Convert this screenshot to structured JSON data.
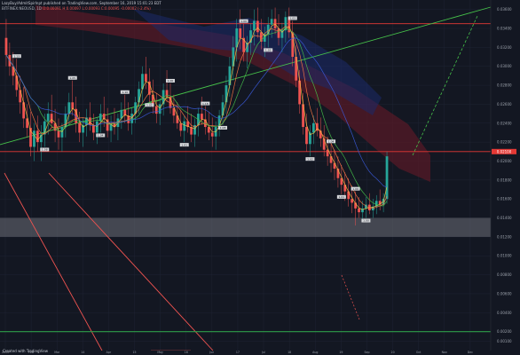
{
  "header": {
    "line1": "LazyBuy/AdmitSpirInpt published on TradingView.com, September 16, 2019 15:01:23 EDT",
    "line2_symbol": "BITFINEX:NEOUSD, 1D",
    "line2_ohlc": "O:0.00091 H:0.00097 L:0.00093 C:0.00095 -0.00002 (-2.4%)"
  },
  "footer": {
    "text": "Created with TradingView"
  },
  "chart_data": {
    "type": "candlestick",
    "colors": {
      "background": "#131722",
      "grid": "#1f2433",
      "up": "#26a69a",
      "down": "#ef5350",
      "cloud": "#5a1a26",
      "cloud_alt": "#1c2a6a",
      "zone": "#6e7078",
      "trendline": "#46c24a",
      "level_red": "#e53935",
      "level_green": "#2e9d48",
      "projection": "#46c24a"
    },
    "y_ticks": [
      "0.03600",
      "0.03400",
      "0.03200",
      "0.03000",
      "0.02800",
      "0.02600",
      "0.02400",
      "0.02200",
      "0.02000",
      "0.01800",
      "0.01600",
      "0.01400",
      "0.01200",
      "0.01000",
      "0.00800",
      "0.00600",
      "0.00400",
      "0.00200",
      "0.00100"
    ],
    "x_ticks": [
      "2019",
      "Feb",
      "Mar",
      "14",
      "Apr",
      "15",
      "May",
      "16",
      "Jun",
      "17",
      "Jul",
      "18",
      "Aug",
      "19",
      "Sep",
      "20",
      "Oct",
      "Nov",
      "Dec"
    ],
    "price_badge": "0.02100",
    "level_red_top": "0.03450",
    "level_red_mid": "0.02100",
    "level_green_bottom": "0.00200",
    "zone": [
      "0.01400",
      "0.01200"
    ],
    "pivot_labels": [
      "1.13",
      "1.08",
      "1.05",
      "1.04",
      "1.10",
      "1.02",
      "1.00",
      "1.01",
      "1.18",
      "1.08",
      "1.00",
      "1.03",
      "1.03",
      "1.02",
      "1.04",
      "1.01",
      "1.00",
      "1.00"
    ],
    "candles": [
      [
        0.033,
        0.035,
        0.03,
        0.0312
      ],
      [
        0.0312,
        0.0325,
        0.029,
        0.03
      ],
      [
        0.03,
        0.0315,
        0.028,
        0.029
      ],
      [
        0.029,
        0.0308,
        0.0268,
        0.0275
      ],
      [
        0.0275,
        0.029,
        0.025,
        0.0262
      ],
      [
        0.0262,
        0.0278,
        0.0235,
        0.0245
      ],
      [
        0.0245,
        0.026,
        0.0225,
        0.0235
      ],
      [
        0.0235,
        0.0252,
        0.0205,
        0.0215
      ],
      [
        0.0215,
        0.024,
        0.02,
        0.0232
      ],
      [
        0.0232,
        0.0248,
        0.021,
        0.022
      ],
      [
        0.022,
        0.0238,
        0.02,
        0.0228
      ],
      [
        0.0228,
        0.025,
        0.0215,
        0.0242
      ],
      [
        0.0242,
        0.0262,
        0.0228,
        0.025
      ],
      [
        0.025,
        0.027,
        0.0235,
        0.024
      ],
      [
        0.024,
        0.0255,
        0.022,
        0.0232
      ],
      [
        0.0232,
        0.0245,
        0.0212,
        0.0225
      ],
      [
        0.0225,
        0.024,
        0.021,
        0.0236
      ],
      [
        0.0236,
        0.0258,
        0.0225,
        0.025
      ],
      [
        0.025,
        0.0272,
        0.0238,
        0.0262
      ],
      [
        0.0262,
        0.0285,
        0.0248,
        0.0255
      ],
      [
        0.0255,
        0.0268,
        0.023,
        0.024
      ],
      [
        0.024,
        0.0252,
        0.022,
        0.023
      ],
      [
        0.023,
        0.0246,
        0.0215,
        0.0238
      ],
      [
        0.0238,
        0.0255,
        0.0226,
        0.0246
      ],
      [
        0.0246,
        0.0262,
        0.0232,
        0.0238
      ],
      [
        0.0238,
        0.025,
        0.0222,
        0.023
      ],
      [
        0.023,
        0.0246,
        0.0218,
        0.0242
      ],
      [
        0.0242,
        0.026,
        0.023,
        0.025
      ],
      [
        0.025,
        0.0268,
        0.0236,
        0.0244
      ],
      [
        0.0244,
        0.0256,
        0.0225,
        0.0232
      ],
      [
        0.0232,
        0.0248,
        0.022,
        0.024
      ],
      [
        0.024,
        0.0256,
        0.0228,
        0.0236
      ],
      [
        0.0236,
        0.025,
        0.0222,
        0.0245
      ],
      [
        0.0245,
        0.0262,
        0.0234,
        0.0254
      ],
      [
        0.0254,
        0.027,
        0.024,
        0.0248
      ],
      [
        0.0248,
        0.0262,
        0.0232,
        0.024
      ],
      [
        0.024,
        0.0256,
        0.0228,
        0.025
      ],
      [
        0.025,
        0.0268,
        0.024,
        0.0262
      ],
      [
        0.0262,
        0.0284,
        0.025,
        0.0276
      ],
      [
        0.0276,
        0.03,
        0.0262,
        0.0292
      ],
      [
        0.0292,
        0.031,
        0.0276,
        0.0284
      ],
      [
        0.0284,
        0.0298,
        0.0262,
        0.027
      ],
      [
        0.027,
        0.0286,
        0.025,
        0.0258
      ],
      [
        0.0258,
        0.0272,
        0.024,
        0.025
      ],
      [
        0.025,
        0.0266,
        0.0238,
        0.026
      ],
      [
        0.026,
        0.0282,
        0.0248,
        0.0275
      ],
      [
        0.0275,
        0.0296,
        0.0262,
        0.0268
      ],
      [
        0.0268,
        0.0282,
        0.025,
        0.0256
      ],
      [
        0.0256,
        0.027,
        0.024,
        0.0248
      ],
      [
        0.0248,
        0.0262,
        0.0234,
        0.024
      ],
      [
        0.024,
        0.0254,
        0.0226,
        0.0232
      ],
      [
        0.0232,
        0.0248,
        0.022,
        0.0242
      ],
      [
        0.0242,
        0.0258,
        0.023,
        0.0236
      ],
      [
        0.0236,
        0.025,
        0.022,
        0.0228
      ],
      [
        0.0228,
        0.0245,
        0.0215,
        0.0238
      ],
      [
        0.0238,
        0.0256,
        0.0226,
        0.025
      ],
      [
        0.025,
        0.0268,
        0.0238,
        0.0244
      ],
      [
        0.0244,
        0.0258,
        0.0228,
        0.0236
      ],
      [
        0.0236,
        0.0252,
        0.0222,
        0.023
      ],
      [
        0.023,
        0.0246,
        0.0215,
        0.0226
      ],
      [
        0.0226,
        0.0242,
        0.0212,
        0.0236
      ],
      [
        0.0236,
        0.0254,
        0.0226,
        0.0248
      ],
      [
        0.0248,
        0.027,
        0.0238,
        0.0262
      ],
      [
        0.0262,
        0.029,
        0.025,
        0.028
      ],
      [
        0.028,
        0.031,
        0.0268,
        0.03
      ],
      [
        0.03,
        0.0332,
        0.0285,
        0.032
      ],
      [
        0.032,
        0.035,
        0.0305,
        0.034
      ],
      [
        0.034,
        0.036,
        0.0318,
        0.033
      ],
      [
        0.033,
        0.0345,
        0.0305,
        0.0315
      ],
      [
        0.0315,
        0.0332,
        0.0298,
        0.0325
      ],
      [
        0.0325,
        0.0345,
        0.0312,
        0.0338
      ],
      [
        0.0338,
        0.036,
        0.0322,
        0.0348
      ],
      [
        0.0348,
        0.0362,
        0.033,
        0.0336
      ],
      [
        0.0336,
        0.035,
        0.0318,
        0.0326
      ],
      [
        0.0326,
        0.0342,
        0.031,
        0.0334
      ],
      [
        0.0334,
        0.0352,
        0.032,
        0.0344
      ],
      [
        0.0344,
        0.036,
        0.033,
        0.035
      ],
      [
        0.035,
        0.0362,
        0.0334,
        0.034
      ],
      [
        0.034,
        0.0355,
        0.0322,
        0.033
      ],
      [
        0.033,
        0.0346,
        0.0315,
        0.0338
      ],
      [
        0.0338,
        0.0358,
        0.0325,
        0.0352
      ],
      [
        0.0352,
        0.0362,
        0.033,
        0.0336
      ],
      [
        0.0336,
        0.0348,
        0.03,
        0.031
      ],
      [
        0.031,
        0.0322,
        0.0278,
        0.0285
      ],
      [
        0.0285,
        0.0296,
        0.025,
        0.026
      ],
      [
        0.026,
        0.0272,
        0.0228,
        0.0236
      ],
      [
        0.0236,
        0.025,
        0.021,
        0.0218
      ],
      [
        0.0218,
        0.0238,
        0.0205,
        0.023
      ],
      [
        0.023,
        0.0248,
        0.0218,
        0.024
      ],
      [
        0.024,
        0.0256,
        0.0226,
        0.0232
      ],
      [
        0.0232,
        0.0246,
        0.0215,
        0.0224
      ],
      [
        0.0224,
        0.0238,
        0.0205,
        0.0212
      ],
      [
        0.0212,
        0.0226,
        0.0195,
        0.0205
      ],
      [
        0.0205,
        0.0218,
        0.0188,
        0.0198
      ],
      [
        0.0198,
        0.0212,
        0.018,
        0.0192
      ],
      [
        0.0192,
        0.0205,
        0.0172,
        0.0182
      ],
      [
        0.0182,
        0.0196,
        0.0165,
        0.0175
      ],
      [
        0.0175,
        0.0188,
        0.0158,
        0.0168
      ],
      [
        0.0168,
        0.0182,
        0.0152,
        0.016
      ],
      [
        0.016,
        0.0174,
        0.0145,
        0.0156
      ],
      [
        0.0156,
        0.0168,
        0.0132,
        0.015
      ],
      [
        0.015,
        0.0162,
        0.014,
        0.0146
      ],
      [
        0.0146,
        0.0158,
        0.0136,
        0.015
      ],
      [
        0.015,
        0.0162,
        0.014,
        0.0154
      ],
      [
        0.0154,
        0.0166,
        0.0144,
        0.0148
      ],
      [
        0.0148,
        0.016,
        0.014,
        0.0152
      ],
      [
        0.0152,
        0.0164,
        0.0144,
        0.0158
      ],
      [
        0.0158,
        0.017,
        0.0148,
        0.0154
      ],
      [
        0.0154,
        0.0166,
        0.0146,
        0.016
      ],
      [
        0.016,
        0.021,
        0.0155,
        0.0205
      ]
    ]
  }
}
